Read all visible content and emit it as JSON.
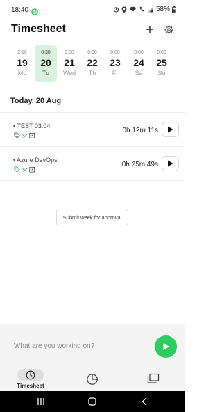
{
  "status": {
    "time": "18:40",
    "battery": "58%"
  },
  "header": {
    "title": "Timesheet"
  },
  "week": [
    {
      "time": "2:16",
      "num": "19",
      "name": "Mo",
      "selected": false
    },
    {
      "time": "0:38",
      "num": "20",
      "name": "Tu",
      "selected": true
    },
    {
      "time": "0:00",
      "num": "21",
      "name": "Wed",
      "selected": false
    },
    {
      "time": "0:00",
      "num": "22",
      "name": "Th",
      "selected": false
    },
    {
      "time": "0:00",
      "num": "23",
      "name": "Fr",
      "selected": false
    },
    {
      "time": "0:00",
      "num": "24",
      "name": "Sa",
      "selected": false
    },
    {
      "time": "0:00",
      "num": "25",
      "name": "Su",
      "selected": false
    }
  ],
  "date_heading": "Today, 20 Aug",
  "entries": [
    {
      "title": "• TEST 03.04",
      "duration": "0h 12m 11s"
    },
    {
      "title": "• Azure DevOps",
      "duration": "0h 25m 49s"
    }
  ],
  "submit_label": "Submit week for approval",
  "composer": {
    "placeholder": "What are you working on?"
  },
  "nav": {
    "timesheet_label": "Timesheet"
  },
  "colors": {
    "accent": "#2ecc5c",
    "selected_day_bg": "#d8f2dd"
  }
}
